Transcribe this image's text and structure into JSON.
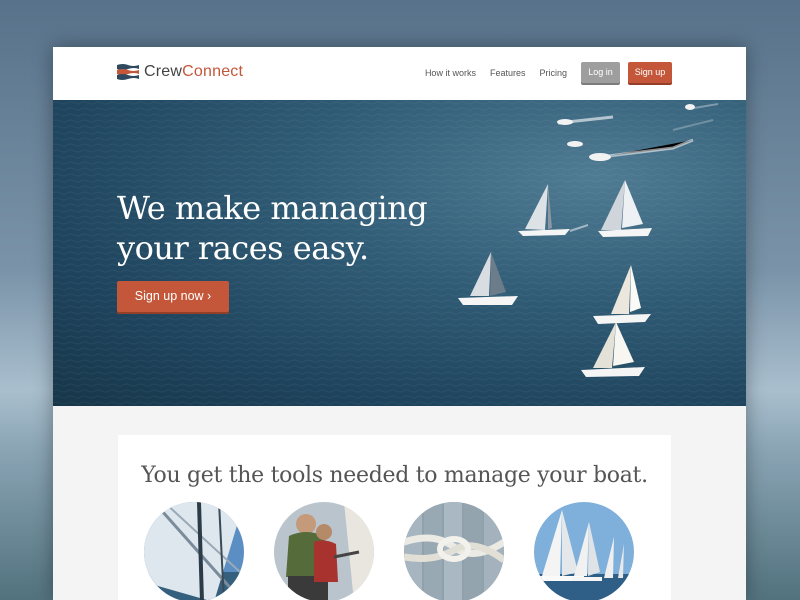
{
  "header": {
    "brand_part1": "Crew",
    "brand_part2": "Connect",
    "nav": [
      "How it works",
      "Features",
      "Pricing"
    ],
    "login_label": "Log in",
    "signup_label": "Sign up"
  },
  "hero": {
    "title": "We make managing your races easy.",
    "cta_label": "Sign up now ›"
  },
  "tools": {
    "title": "You get the tools needed to manage your boat."
  },
  "colors": {
    "accent": "#c4573a",
    "login_button": "#9e9e9e",
    "sea": "#2f5a74"
  }
}
